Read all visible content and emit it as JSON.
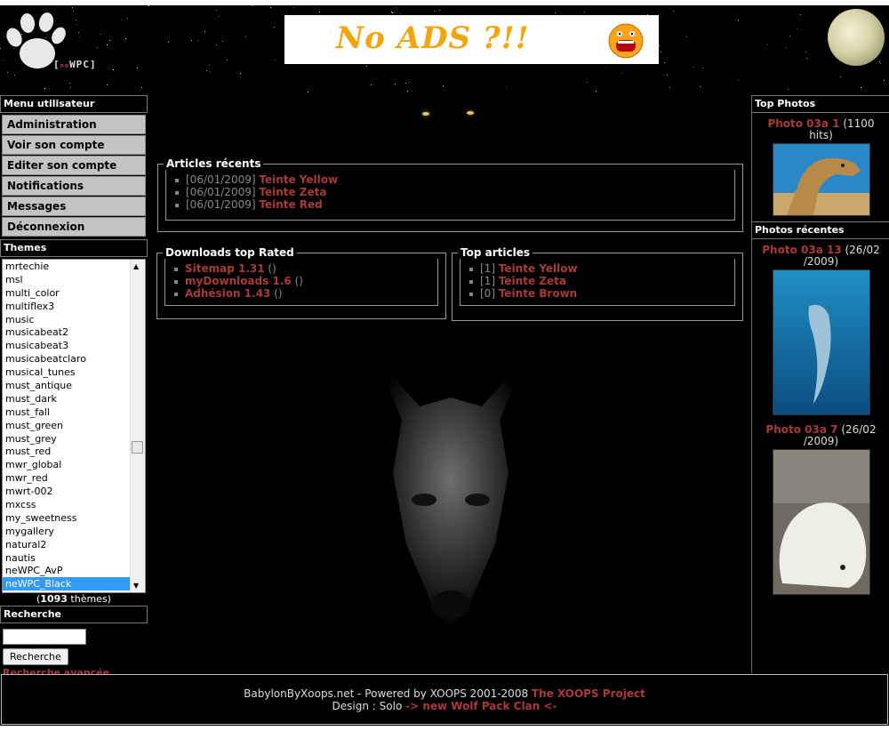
{
  "header": {
    "logo_text": "WPC",
    "logo_prefix": "ne",
    "banner_text": "No ADS ?!!"
  },
  "user_menu": {
    "title": "Menu utilisateur",
    "items": [
      "Administration",
      "Voir son compte",
      "Editer son compte",
      "Notifications",
      "Messages",
      "Déconnexion"
    ]
  },
  "themes": {
    "title": "Themes",
    "options": [
      "mrtechie",
      "msl",
      "multi_color",
      "multiflex3",
      "music",
      "musicabeat2",
      "musicabeat3",
      "musicabeatclaro",
      "musical_tunes",
      "must_antique",
      "must_dark",
      "must_fall",
      "must_green",
      "must_grey",
      "must_red",
      "mwr_global",
      "mwr_red",
      "mwrt-002",
      "mxcss",
      "my_sweetness",
      "mygallery",
      "natural2",
      "nautis",
      "neWPC_AvP",
      "neWPC_Black"
    ],
    "selected": "neWPC_Black",
    "count": "1093",
    "count_suffix": " thèmes)",
    "count_prefix": "("
  },
  "search": {
    "title": "Recherche",
    "input_value": "",
    "button_label": "Recherche",
    "advanced_link": "Recherche avancée"
  },
  "recent_articles": {
    "title": "Articles récents",
    "items": [
      {
        "date": "[06/01/2009]",
        "title": "Teinte Yellow"
      },
      {
        "date": "[06/01/2009]",
        "title": "Teinte Zeta"
      },
      {
        "date": "[06/01/2009]",
        "title": "Teinte Red"
      }
    ]
  },
  "downloads": {
    "title": "Downloads top Rated",
    "items": [
      {
        "title": "Sitemap 1.31",
        "suffix": " ()"
      },
      {
        "title": "myDownloads 1.6",
        "suffix": " ()"
      },
      {
        "title": "Adhésion 1.43",
        "suffix": " ()"
      }
    ]
  },
  "top_articles": {
    "title": "Top articles",
    "items": [
      {
        "rank": "[1]",
        "title": "Teinte Yellow"
      },
      {
        "rank": "[1]",
        "title": "Teinte Zeta"
      },
      {
        "rank": "[0]",
        "title": "Teinte Brown"
      }
    ]
  },
  "top_photos": {
    "title": "Top Photos",
    "items": [
      {
        "title": "Photo 03a 1",
        "meta": " (1100 hits)"
      }
    ]
  },
  "recent_photos": {
    "title": "Photos récentes",
    "items": [
      {
        "title": "Photo 03a 13",
        "meta": " (26/02 /2009)"
      },
      {
        "title": "Photo 03a 7",
        "meta": " (26/02 /2009)"
      }
    ]
  },
  "footer": {
    "line1_text": "BabylonByXoops.net - Powered by XOOPS 2001-2008 ",
    "line1_link": "The XOOPS Project",
    "line2_text": "Design : Solo ",
    "line2_link": "-> new Wolf Pack Clan <-"
  },
  "colors": {
    "link": "#a83a3a",
    "selection": "#3399ff",
    "menu_bg": "#c3c3c3"
  }
}
